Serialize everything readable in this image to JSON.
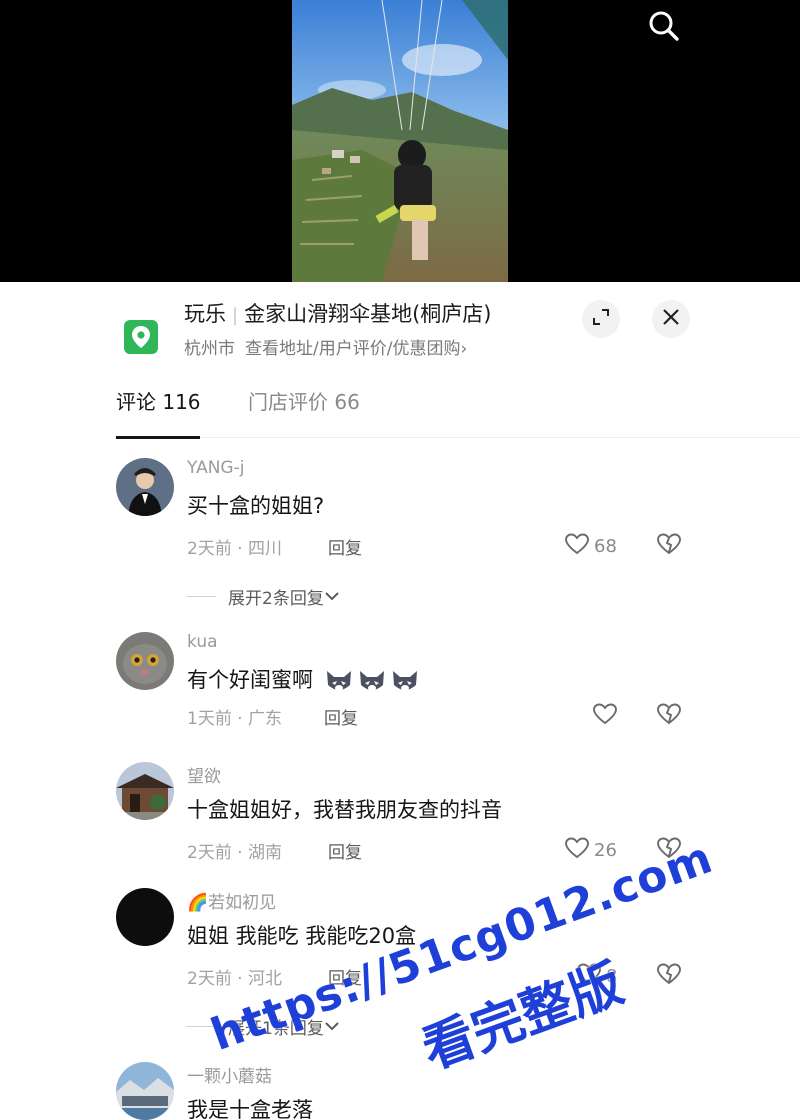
{
  "poi": {
    "category": "玩乐",
    "name": "金家山滑翔伞基地(桐庐店)",
    "city": "杭州市",
    "links": "查看地址/用户评价/优惠团购",
    "chevron": "›"
  },
  "tabs": [
    {
      "label": "评论 116",
      "active": true
    },
    {
      "label": "门店评价 66",
      "active": false
    }
  ],
  "comments": [
    {
      "user": "YANG-j",
      "text": "买十盒的姐姐?",
      "meta": "2天前 · 四川",
      "reply": "回复",
      "likes": "68",
      "expand": "展开2条回复"
    },
    {
      "user": "kua",
      "text": "有个好闺蜜啊",
      "emojis": [
        "wolf-emoji",
        "wolf-emoji",
        "wolf-emoji"
      ],
      "meta": "1天前 · 广东",
      "reply": "回复",
      "likes": ""
    },
    {
      "user": "望欲",
      "text": "十盒姐姐好，我替我朋友查的抖音",
      "meta": "2天前 · 湖南",
      "reply": "回复",
      "likes": "26"
    },
    {
      "user": "🌈若如初见",
      "text": "姐姐  我能吃 我能吃20盒",
      "meta": "2天前 · 河北",
      "reply": "回复",
      "likes": "8",
      "expand": "展开1条回复"
    },
    {
      "user": "一颗小蘑菇",
      "text": "我是十盒老落",
      "meta": "",
      "reply": "",
      "likes": ""
    }
  ],
  "watermark": {
    "line1": "https://51cg012.com",
    "line2": "看完整版"
  },
  "colors": {
    "accent_green": "#2fb659",
    "watermark_blue": "#1e3fd8",
    "text_primary": "#161616",
    "text_secondary": "#9a9a9a"
  }
}
